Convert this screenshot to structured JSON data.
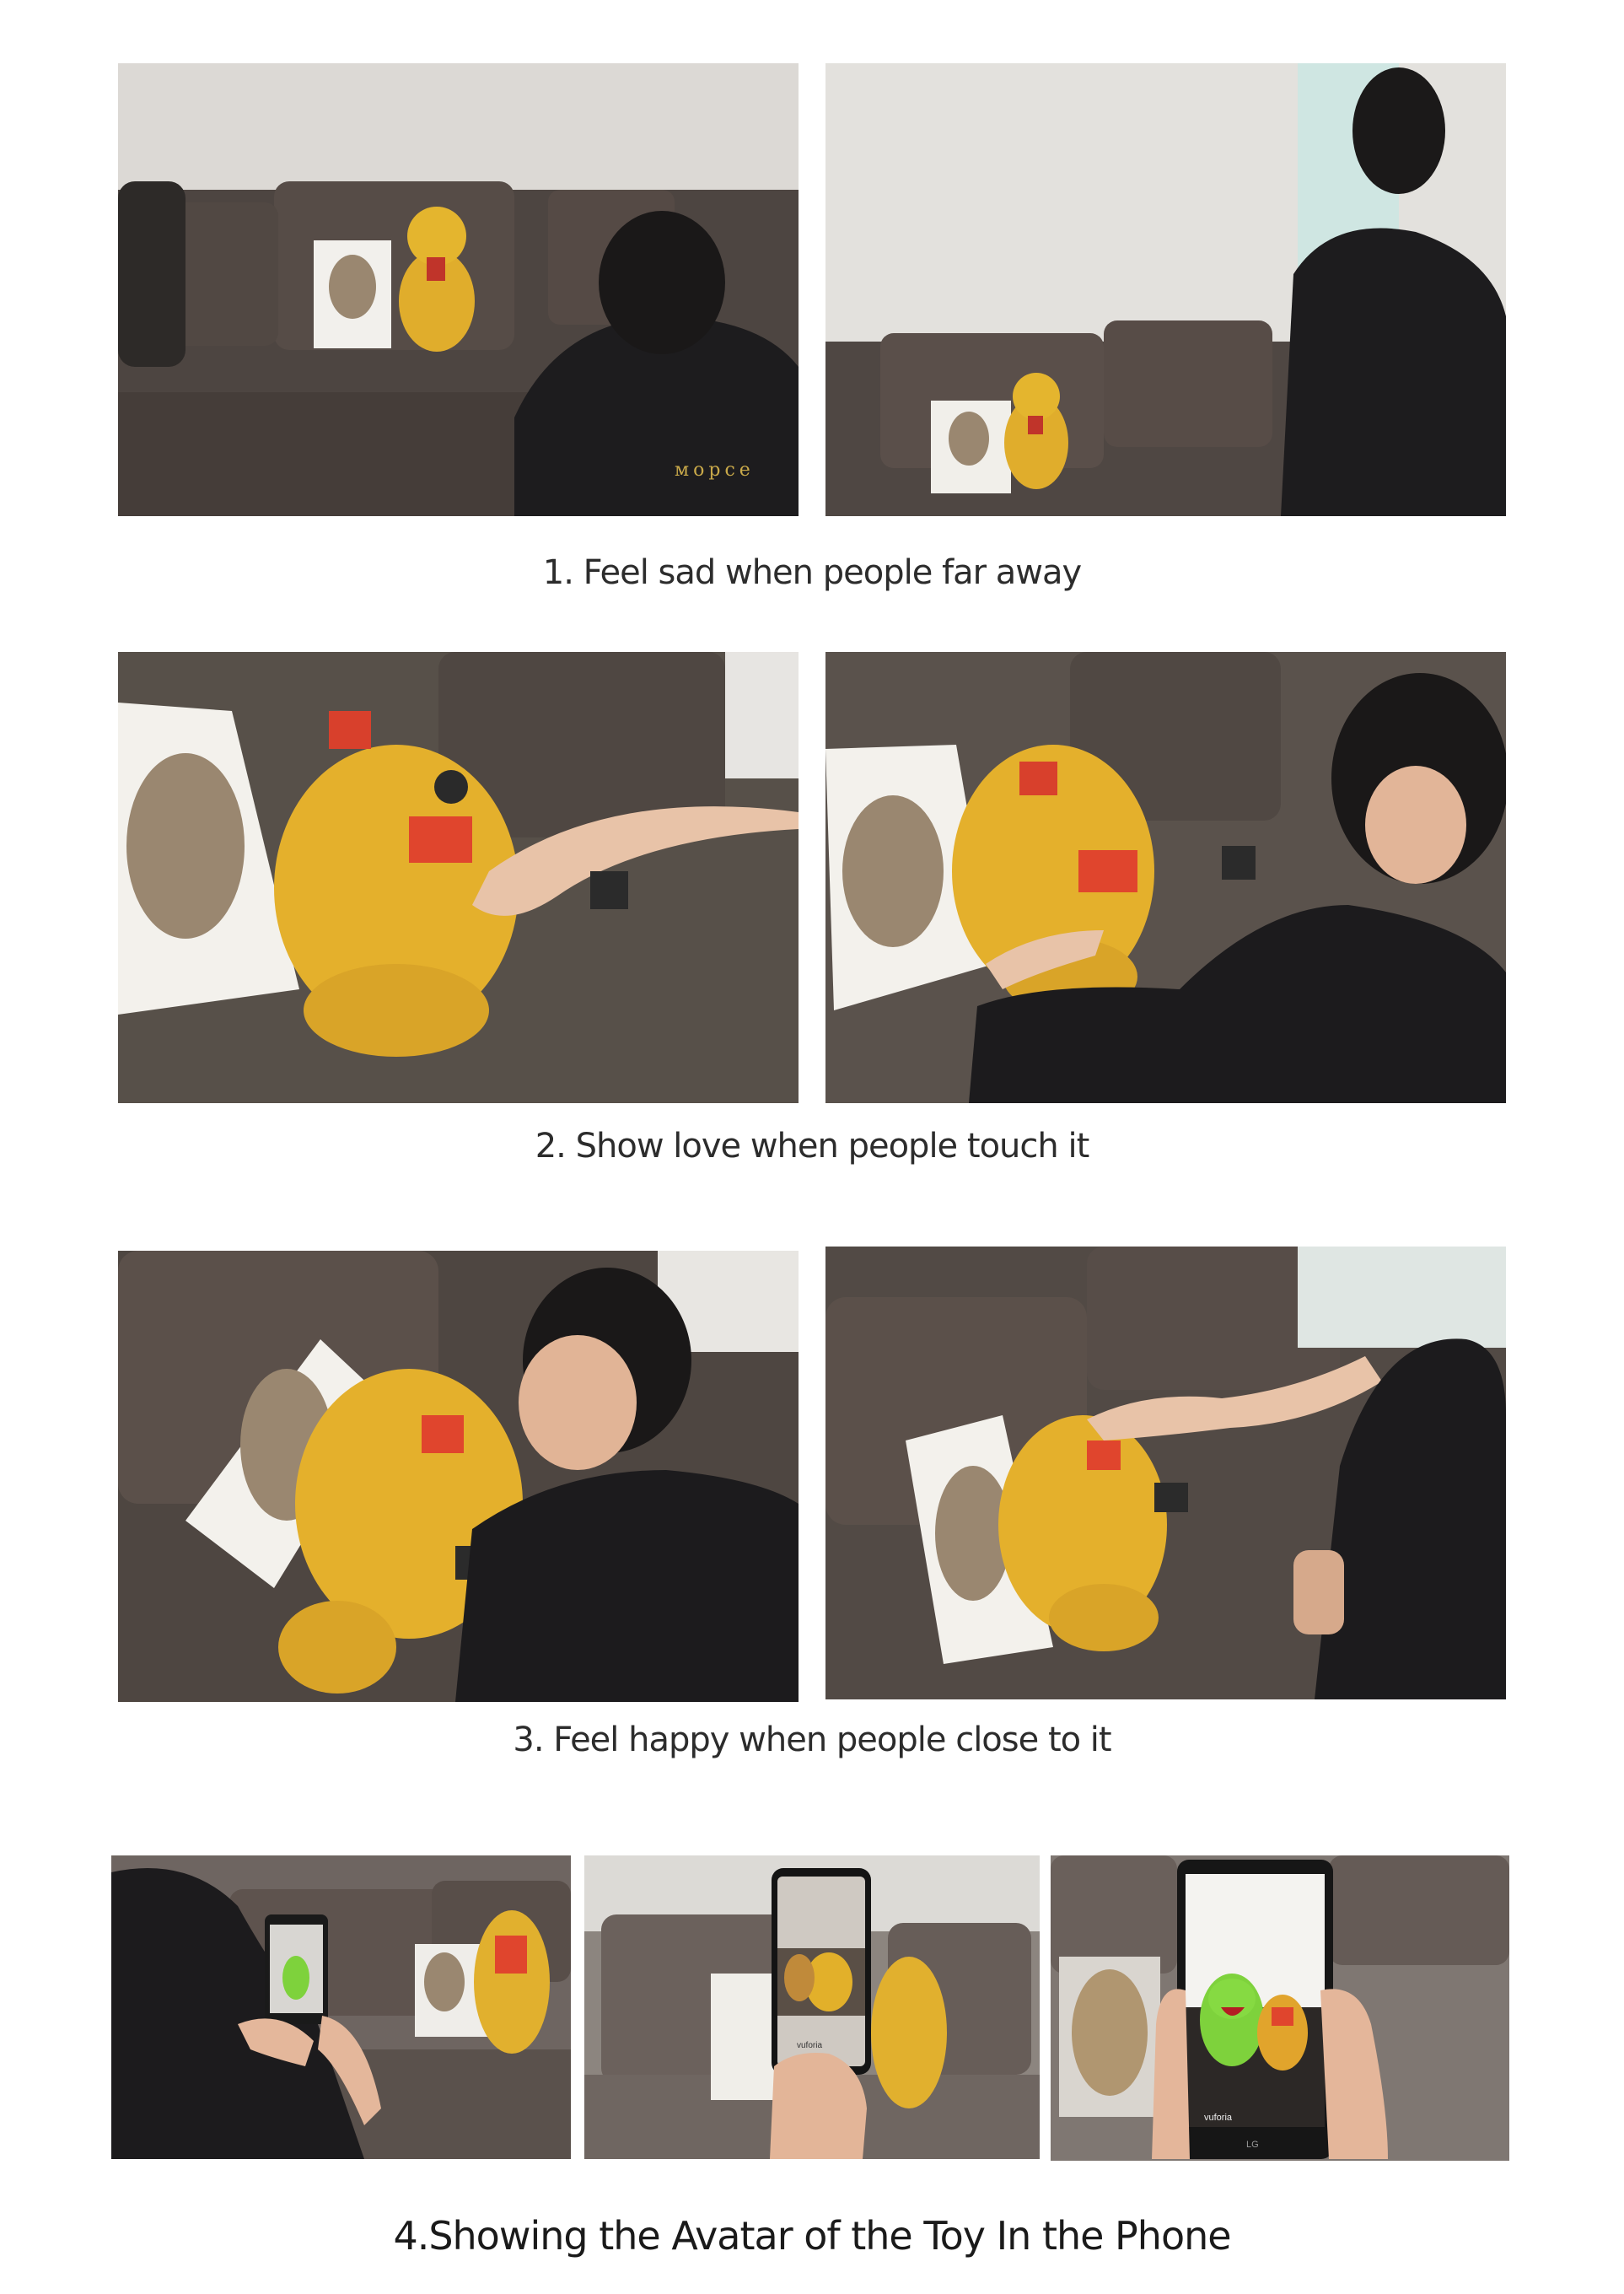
{
  "rows": [
    {
      "caption": "1. Feel sad when people far away"
    },
    {
      "caption": "2. Show love when people touch it"
    },
    {
      "caption": "3. Feel happy when people close to it"
    },
    {
      "caption": "4.Showing the Avatar of the Toy In the Phone"
    }
  ],
  "photo_text": {
    "hoodie_print": "морсе",
    "ar_watermark": "vuforia",
    "phone_brand": "LG"
  },
  "colors": {
    "background": "#ffffff",
    "caption_text": "#2c2c2c",
    "sofa": "#5e5550",
    "toy_yellow": "#e2b12a",
    "led_red": "#e0412a",
    "avatar_green": "#7ed23c"
  }
}
